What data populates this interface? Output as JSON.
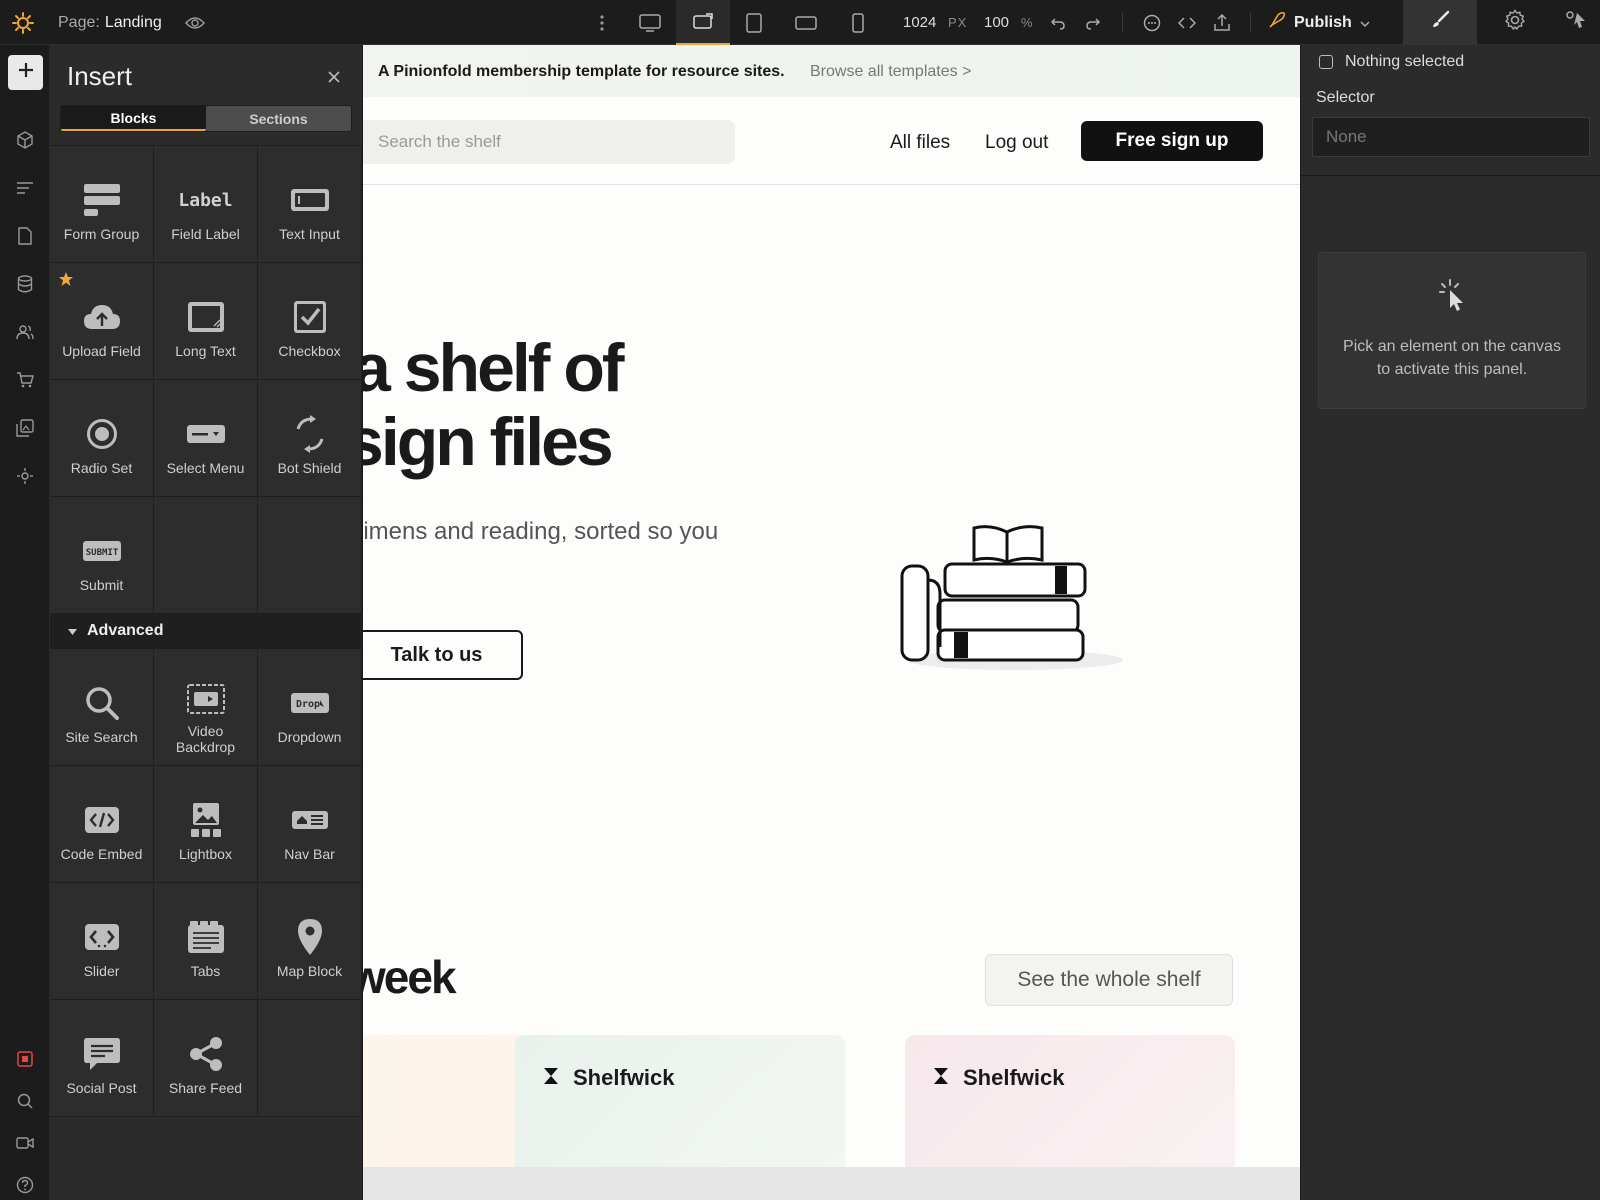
{
  "topbar": {
    "page_prefix": "Page:",
    "page_name": "Landing",
    "width_value": "1024",
    "width_unit": "PX",
    "zoom_value": "100",
    "zoom_unit": "%",
    "publish_label": "Publish"
  },
  "insert": {
    "title": "Insert",
    "tabs": [
      "Blocks",
      "Sections"
    ],
    "blocks": [
      {
        "label": "Form Group",
        "icon": "form-group-icon"
      },
      {
        "label": "Field Label",
        "icon": "field-label-icon",
        "glyph": "Label"
      },
      {
        "label": "Text Input",
        "icon": "text-input-icon"
      },
      {
        "label": "Upload Field",
        "icon": "upload-field-icon",
        "starred": true
      },
      {
        "label": "Long Text",
        "icon": "long-text-icon"
      },
      {
        "label": "Checkbox",
        "icon": "checkbox-icon"
      },
      {
        "label": "Radio Set",
        "icon": "radio-set-icon"
      },
      {
        "label": "Select Menu",
        "icon": "select-menu-icon"
      },
      {
        "label": "Bot Shield",
        "icon": "bot-shield-icon"
      },
      {
        "label": "Submit",
        "icon": "submit-icon",
        "glyph": "SUBMIT"
      }
    ],
    "advanced_label": "Advanced",
    "advanced": [
      {
        "label": "Site Search",
        "icon": "site-search-icon"
      },
      {
        "label": "Video Backdrop",
        "icon": "video-backdrop-icon"
      },
      {
        "label": "Dropdown",
        "icon": "dropdown-icon",
        "glyph": "Drop"
      },
      {
        "label": "Code Embed",
        "icon": "code-embed-icon"
      },
      {
        "label": "Lightbox",
        "icon": "lightbox-icon"
      },
      {
        "label": "Nav Bar",
        "icon": "nav-bar-icon"
      },
      {
        "label": "Slider",
        "icon": "slider-icon"
      },
      {
        "label": "Tabs",
        "icon": "tabs-icon"
      },
      {
        "label": "Map Block",
        "icon": "map-block-icon"
      },
      {
        "label": "Social Post",
        "icon": "social-post-icon"
      },
      {
        "label": "Share Feed",
        "icon": "share-feed-icon"
      }
    ]
  },
  "canvas": {
    "banner_text": "A Pinionfold membership template for resource sites.",
    "banner_link": "Browse all templates >",
    "search_placeholder": "Search the shelf",
    "nav": [
      "All files",
      "Log out"
    ],
    "signup_label": "Free sign up",
    "hero_line1": "a shelf of",
    "hero_line2": "sign files",
    "hero_sub": "ecimens and reading, sorted so you",
    "talk_label": "Talk to us",
    "week_heading": "week",
    "whole_shelf_label": "See the whole shelf",
    "card_brand": "Shelfwick"
  },
  "right_panel": {
    "nothing_selected": "Nothing selected",
    "selector_label": "Selector",
    "selector_value": "None",
    "hint": "Pick an element on the canvas to activate this panel."
  },
  "colors": {
    "accent": "#f0a43a",
    "panel_bg": "#2b2b2b",
    "canvas_bg": "#fdfdfb",
    "record_red": "#e04848"
  }
}
